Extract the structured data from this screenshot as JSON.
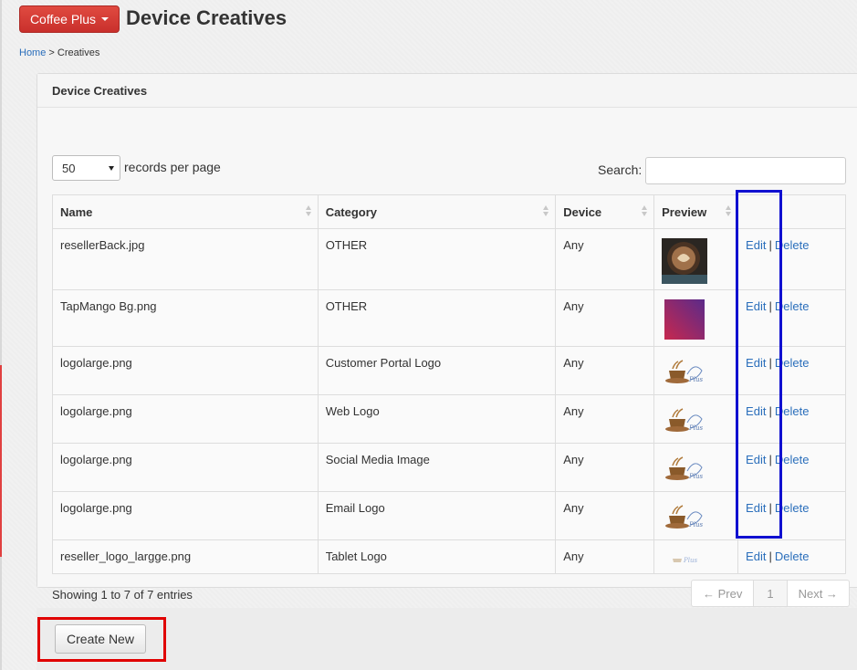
{
  "header": {
    "brand_button": "Coffee Plus",
    "title": "Device Creatives"
  },
  "breadcrumb": {
    "home": "Home",
    "separator": ">",
    "current": "Creatives"
  },
  "panel": {
    "title": "Device Creatives"
  },
  "table_controls": {
    "page_length": "50",
    "page_length_label": "records per page",
    "search_label": "Search:",
    "search_value": ""
  },
  "table": {
    "columns": [
      "Name",
      "Category",
      "Device",
      "Preview",
      ""
    ],
    "rows": [
      {
        "name": "resellerBack.jpg",
        "category": "OTHER",
        "device": "Any",
        "preview": "coffee-latte-thumbnail"
      },
      {
        "name": "TapMango Bg.png",
        "category": "OTHER",
        "device": "Any",
        "preview": "gradient-background-thumbnail"
      },
      {
        "name": "logolarge.png",
        "category": "Customer Portal Logo",
        "device": "Any",
        "preview": "coffee-plus-logo-thumbnail"
      },
      {
        "name": "logolarge.png",
        "category": "Web Logo",
        "device": "Any",
        "preview": "coffee-plus-logo-thumbnail"
      },
      {
        "name": "logolarge.png",
        "category": "Social Media Image",
        "device": "Any",
        "preview": "coffee-plus-logo-thumbnail"
      },
      {
        "name": "logolarge.png",
        "category": "Email Logo",
        "device": "Any",
        "preview": "coffee-plus-logo-thumbnail"
      },
      {
        "name": "reseller_logo_largge.png",
        "category": "Tablet Logo",
        "device": "Any",
        "preview": "coffee-plus-small-logo-thumbnail"
      }
    ],
    "edit_label": "Edit",
    "action_separator": "|",
    "delete_label": "Delete"
  },
  "footer": {
    "info": "Showing 1 to 7 of 7 entries",
    "prev": "← Prev",
    "page": "1",
    "next": "Next →"
  },
  "actions": {
    "create_new": "Create New"
  },
  "colors": {
    "brand_red": "#d9534f",
    "link_blue": "#2a6ebb",
    "highlight_red": "#e00000",
    "highlight_blue": "#1010d0"
  }
}
